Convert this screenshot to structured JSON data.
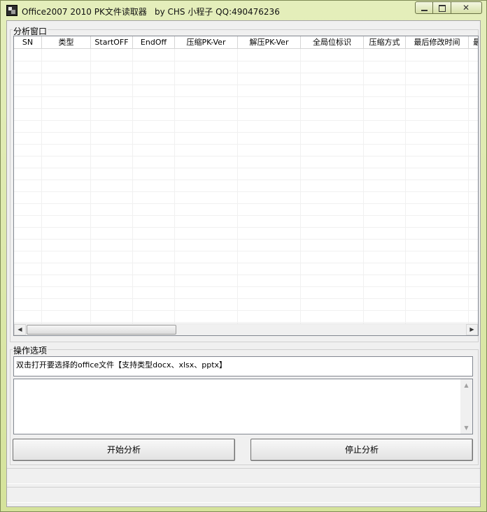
{
  "window": {
    "title": "Office2007 2010 PK文件读取器",
    "author": "by CHS 小程子 QQ:490476236"
  },
  "analysis": {
    "group_label": "分析窗口",
    "columns": [
      "SN",
      "类型",
      "StartOFF",
      "EndOff",
      "压缩PK-Ver",
      "解压PK-Ver",
      "全局位标识",
      "压缩方式",
      "最后修改时间",
      "最"
    ],
    "rows": []
  },
  "options": {
    "group_label": "操作选项",
    "hint_text": "双击打开要选择的office文件【支持类型docx、xlsx、pptx】",
    "log_text": "",
    "start_button": "开始分析",
    "stop_button": "停止分析"
  },
  "status": {
    "line1": "",
    "line2": ""
  }
}
